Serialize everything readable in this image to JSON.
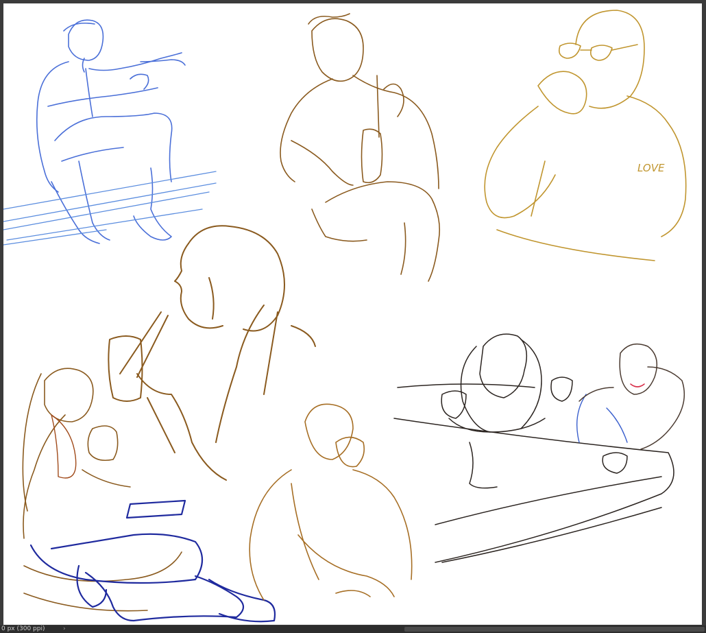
{
  "canvas": {
    "paper_color": "#ffffff",
    "background_color": "#3b3b3b",
    "stroke_colors": {
      "blue": "#3a5fcd",
      "navy": "#1f2a9e",
      "brown": "#8a5a1e",
      "ochre": "#c0952e",
      "dark": "#2b2420",
      "rust": "#a04a1a"
    },
    "annotation_text": "LOVE"
  },
  "statusbar": {
    "zoom_info": "0 px (300 ppi)",
    "nav_icon": "chevron-icon",
    "nav_glyph": "›"
  }
}
